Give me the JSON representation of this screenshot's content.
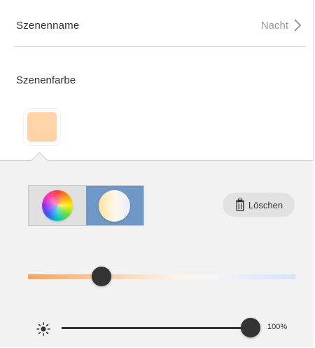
{
  "scene": {
    "name_label": "Szenenname",
    "name_value": "Nacht",
    "color_label": "Szenenfarbe",
    "swatch_color": "#ffd3a8"
  },
  "editor": {
    "modes": [
      {
        "name": "color",
        "icon": "color-wheel-icon",
        "selected": false
      },
      {
        "name": "white",
        "icon": "white-temperature-icon",
        "selected": true
      }
    ],
    "delete_label": "Löschen",
    "color_temperature_level": 0.27,
    "brightness_label": "100%",
    "brightness_level": 1.0
  }
}
